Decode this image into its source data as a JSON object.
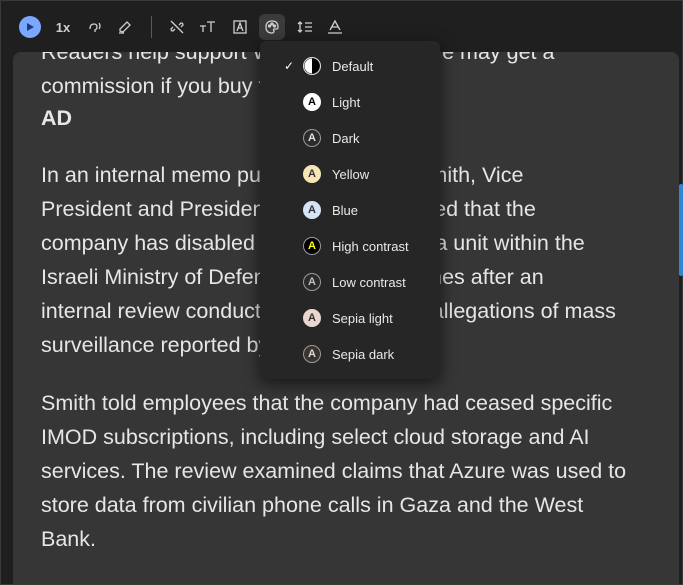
{
  "toolbar": {
    "speed_label": "1x",
    "items": [
      "play-icon",
      "voice-icon",
      "highlighter-icon",
      "link-off-icon",
      "text-size-icon",
      "text-box-icon",
      "palette-icon",
      "line-spacing-icon",
      "font-icon"
    ]
  },
  "article": {
    "top_line_1": "Readers help support Windows Report. We may get a",
    "top_line_2": "commission if you buy through our links.",
    "ad_label": "AD",
    "para1": [
      "In an internal memo published by Brad Smith, Vice",
      "President and President, Microsoft revealed that the",
      "company has disabled some services for a unit within the",
      "Israeli Ministry of Defense. The move comes after an",
      "internal review conducted in response to allegations of mass",
      "surveillance reported by"
    ],
    "para2": [
      "Smith told employees that the company had ceased specific",
      "IMOD subscriptions, including select cloud storage and AI",
      "services. The review examined claims that Azure was used to",
      "store data from civilian phone calls in Gaza and the West",
      "Bank."
    ]
  },
  "theme_menu": {
    "items": [
      {
        "label": "Default",
        "checked": true,
        "swatch_bg": "#ffffff",
        "swatch_fg": "#000000"
      },
      {
        "label": "Light",
        "checked": false,
        "swatch_bg": "#ffffff",
        "swatch_fg": "#000000"
      },
      {
        "label": "Dark",
        "checked": false,
        "swatch_bg": "#2b2b2b",
        "swatch_fg": "#e0e0e0"
      },
      {
        "label": "Yellow",
        "checked": false,
        "swatch_bg": "#f7e6b5",
        "swatch_fg": "#333333"
      },
      {
        "label": "Blue",
        "checked": false,
        "swatch_bg": "#d7e4f7",
        "swatch_fg": "#333333"
      },
      {
        "label": "High contrast",
        "checked": false,
        "swatch_bg": "#000000",
        "swatch_fg": "#ffff00"
      },
      {
        "label": "Low contrast",
        "checked": false,
        "swatch_bg": "#2b2b2b",
        "swatch_fg": "#bfbfbf"
      },
      {
        "label": "Sepia light",
        "checked": false,
        "swatch_bg": "#e9d7cf",
        "swatch_fg": "#333333"
      },
      {
        "label": "Sepia dark",
        "checked": false,
        "swatch_bg": "#3a3431",
        "swatch_fg": "#d8d8d8"
      }
    ],
    "check_glyph": "✓",
    "swatch_letter": "A"
  },
  "colors": {
    "accent": "#7aa7ff",
    "scrollbar": "#2f86d6"
  }
}
